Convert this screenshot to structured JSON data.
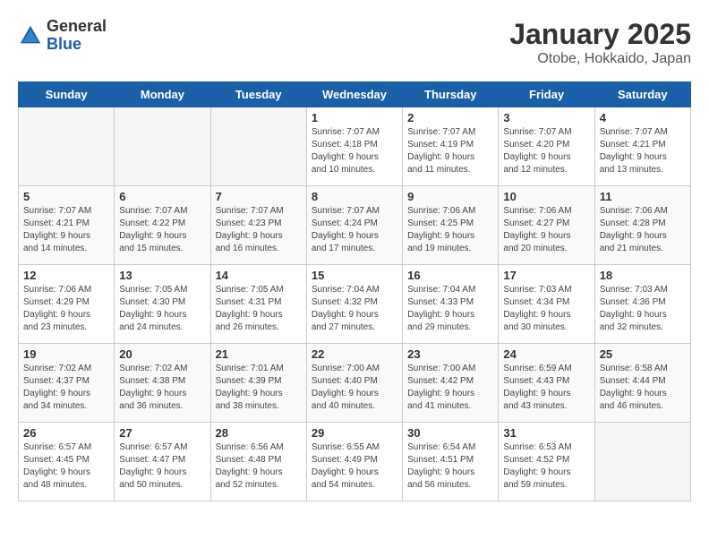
{
  "header": {
    "logo_general": "General",
    "logo_blue": "Blue",
    "title": "January 2025",
    "subtitle": "Otobe, Hokkaido, Japan"
  },
  "weekdays": [
    "Sunday",
    "Monday",
    "Tuesday",
    "Wednesday",
    "Thursday",
    "Friday",
    "Saturday"
  ],
  "weeks": [
    [
      {
        "day": "",
        "info": ""
      },
      {
        "day": "",
        "info": ""
      },
      {
        "day": "",
        "info": ""
      },
      {
        "day": "1",
        "info": "Sunrise: 7:07 AM\nSunset: 4:18 PM\nDaylight: 9 hours\nand 10 minutes."
      },
      {
        "day": "2",
        "info": "Sunrise: 7:07 AM\nSunset: 4:19 PM\nDaylight: 9 hours\nand 11 minutes."
      },
      {
        "day": "3",
        "info": "Sunrise: 7:07 AM\nSunset: 4:20 PM\nDaylight: 9 hours\nand 12 minutes."
      },
      {
        "day": "4",
        "info": "Sunrise: 7:07 AM\nSunset: 4:21 PM\nDaylight: 9 hours\nand 13 minutes."
      }
    ],
    [
      {
        "day": "5",
        "info": "Sunrise: 7:07 AM\nSunset: 4:21 PM\nDaylight: 9 hours\nand 14 minutes."
      },
      {
        "day": "6",
        "info": "Sunrise: 7:07 AM\nSunset: 4:22 PM\nDaylight: 9 hours\nand 15 minutes."
      },
      {
        "day": "7",
        "info": "Sunrise: 7:07 AM\nSunset: 4:23 PM\nDaylight: 9 hours\nand 16 minutes."
      },
      {
        "day": "8",
        "info": "Sunrise: 7:07 AM\nSunset: 4:24 PM\nDaylight: 9 hours\nand 17 minutes."
      },
      {
        "day": "9",
        "info": "Sunrise: 7:06 AM\nSunset: 4:25 PM\nDaylight: 9 hours\nand 19 minutes."
      },
      {
        "day": "10",
        "info": "Sunrise: 7:06 AM\nSunset: 4:27 PM\nDaylight: 9 hours\nand 20 minutes."
      },
      {
        "day": "11",
        "info": "Sunrise: 7:06 AM\nSunset: 4:28 PM\nDaylight: 9 hours\nand 21 minutes."
      }
    ],
    [
      {
        "day": "12",
        "info": "Sunrise: 7:06 AM\nSunset: 4:29 PM\nDaylight: 9 hours\nand 23 minutes."
      },
      {
        "day": "13",
        "info": "Sunrise: 7:05 AM\nSunset: 4:30 PM\nDaylight: 9 hours\nand 24 minutes."
      },
      {
        "day": "14",
        "info": "Sunrise: 7:05 AM\nSunset: 4:31 PM\nDaylight: 9 hours\nand 26 minutes."
      },
      {
        "day": "15",
        "info": "Sunrise: 7:04 AM\nSunset: 4:32 PM\nDaylight: 9 hours\nand 27 minutes."
      },
      {
        "day": "16",
        "info": "Sunrise: 7:04 AM\nSunset: 4:33 PM\nDaylight: 9 hours\nand 29 minutes."
      },
      {
        "day": "17",
        "info": "Sunrise: 7:03 AM\nSunset: 4:34 PM\nDaylight: 9 hours\nand 30 minutes."
      },
      {
        "day": "18",
        "info": "Sunrise: 7:03 AM\nSunset: 4:36 PM\nDaylight: 9 hours\nand 32 minutes."
      }
    ],
    [
      {
        "day": "19",
        "info": "Sunrise: 7:02 AM\nSunset: 4:37 PM\nDaylight: 9 hours\nand 34 minutes."
      },
      {
        "day": "20",
        "info": "Sunrise: 7:02 AM\nSunset: 4:38 PM\nDaylight: 9 hours\nand 36 minutes."
      },
      {
        "day": "21",
        "info": "Sunrise: 7:01 AM\nSunset: 4:39 PM\nDaylight: 9 hours\nand 38 minutes."
      },
      {
        "day": "22",
        "info": "Sunrise: 7:00 AM\nSunset: 4:40 PM\nDaylight: 9 hours\nand 40 minutes."
      },
      {
        "day": "23",
        "info": "Sunrise: 7:00 AM\nSunset: 4:42 PM\nDaylight: 9 hours\nand 41 minutes."
      },
      {
        "day": "24",
        "info": "Sunrise: 6:59 AM\nSunset: 4:43 PM\nDaylight: 9 hours\nand 43 minutes."
      },
      {
        "day": "25",
        "info": "Sunrise: 6:58 AM\nSunset: 4:44 PM\nDaylight: 9 hours\nand 46 minutes."
      }
    ],
    [
      {
        "day": "26",
        "info": "Sunrise: 6:57 AM\nSunset: 4:45 PM\nDaylight: 9 hours\nand 48 minutes."
      },
      {
        "day": "27",
        "info": "Sunrise: 6:57 AM\nSunset: 4:47 PM\nDaylight: 9 hours\nand 50 minutes."
      },
      {
        "day": "28",
        "info": "Sunrise: 6:56 AM\nSunset: 4:48 PM\nDaylight: 9 hours\nand 52 minutes."
      },
      {
        "day": "29",
        "info": "Sunrise: 6:55 AM\nSunset: 4:49 PM\nDaylight: 9 hours\nand 54 minutes."
      },
      {
        "day": "30",
        "info": "Sunrise: 6:54 AM\nSunset: 4:51 PM\nDaylight: 9 hours\nand 56 minutes."
      },
      {
        "day": "31",
        "info": "Sunrise: 6:53 AM\nSunset: 4:52 PM\nDaylight: 9 hours\nand 59 minutes."
      },
      {
        "day": "",
        "info": ""
      }
    ]
  ]
}
